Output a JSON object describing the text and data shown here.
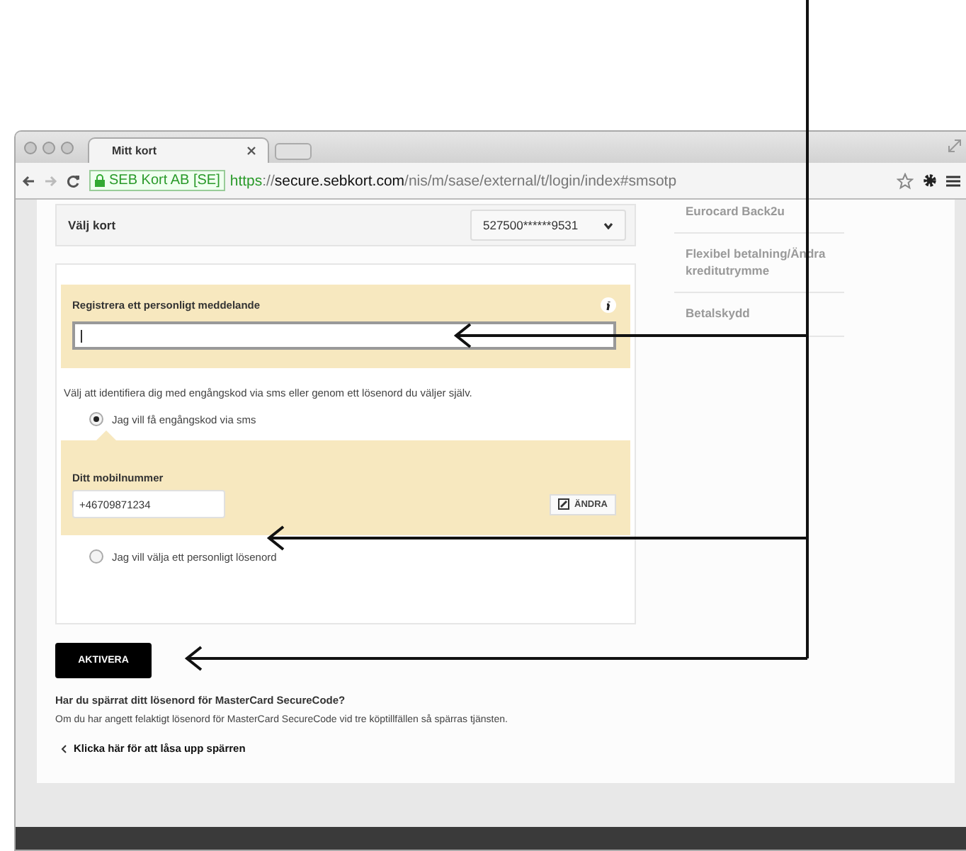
{
  "browser": {
    "tab": {
      "title": "Mitt kort"
    },
    "address_bar": {
      "identity": "SEB Kort AB [SE]",
      "scheme": "https",
      "separator": "://",
      "host": "secure.sebkort.com",
      "path": "/nis/m/sase/external/t/login/index#smsotp"
    }
  },
  "card_selector": {
    "label": "Välj kort",
    "value": "527500******9531"
  },
  "message_panel": {
    "label": "Registrera ett personligt meddelande",
    "focused": true
  },
  "instruction": "Välj att identifiera dig med engångskod via sms eller genom ett lösenord du väljer själv.",
  "options": [
    {
      "label": "Jag vill få engångskod via sms",
      "selected": true
    },
    {
      "label": "Jag vill välja ett personligt lösenord",
      "selected": false
    }
  ],
  "mobile_panel": {
    "label": "Ditt mobilnummer",
    "value": "+46709871234",
    "button": "ÄNDRA"
  },
  "activate_button": "AKTIVERA",
  "blocked_info": {
    "title": "Har du spärrat ditt lösenord för MasterCard SecureCode?",
    "text": "Om du har angett felaktigt lösenord för MasterCard SecureCode vid tre köptillfällen så spärras tjänsten.",
    "link": "Klicka här för att låsa upp spärren"
  },
  "sidebar": {
    "items": [
      {
        "label": "Eurocard Back2u"
      },
      {
        "label": "Flexibel betalning/Ändra kreditutrymme"
      },
      {
        "label": "Betalskydd"
      }
    ]
  }
}
